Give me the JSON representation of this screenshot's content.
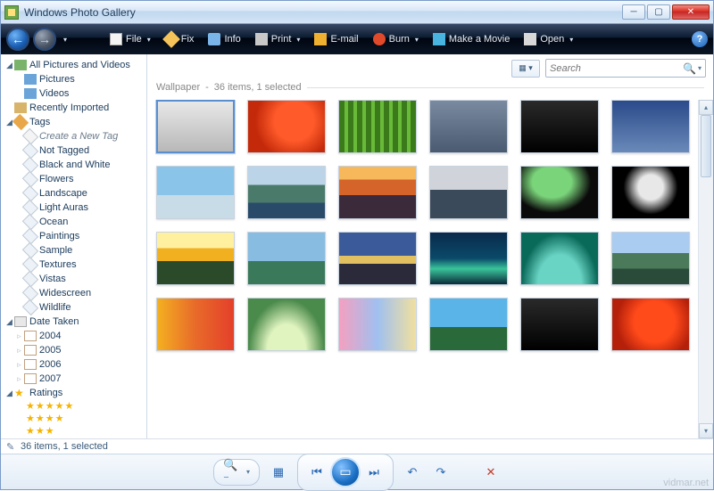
{
  "window": {
    "title": "Windows Photo Gallery"
  },
  "toolbar": {
    "file": "File",
    "fix": "Fix",
    "info": "Info",
    "print": "Print",
    "email": "E-mail",
    "burn": "Burn",
    "movie": "Make a Movie",
    "open": "Open"
  },
  "search": {
    "placeholder": "Search"
  },
  "tree": {
    "root": "All Pictures and Videos",
    "pictures": "Pictures",
    "videos": "Videos",
    "recent": "Recently Imported",
    "tags": "Tags",
    "create_tag": "Create a New Tag",
    "tag_items": [
      "Not Tagged",
      "Black and White",
      "Flowers",
      "Landscape",
      "Light Auras",
      "Ocean",
      "Paintings",
      "Sample",
      "Textures",
      "Vistas",
      "Widescreen",
      "Wildlife"
    ],
    "date": "Date Taken",
    "years": [
      "2004",
      "2005",
      "2006",
      "2007"
    ],
    "ratings": "Ratings"
  },
  "breadcrumb": {
    "folder": "Wallpaper",
    "summary": "36 items, 1 selected"
  },
  "status": {
    "text": "36 items, 1 selected"
  },
  "thumbs": {
    "count": 24,
    "selected_index": 0,
    "classes": [
      "g1",
      "g2",
      "g3",
      "g4",
      "g5",
      "g6",
      "g7",
      "g8",
      "g9",
      "g10",
      "g11",
      "g12",
      "g13",
      "g14",
      "g15",
      "g16",
      "g17",
      "g18",
      "g19",
      "g20",
      "g21",
      "g22",
      "g23",
      "g24"
    ]
  },
  "watermark": "vidmar.net",
  "icons": {
    "file": "#f4f4f4",
    "fix": "#f4c45a",
    "info": "#7ab4e8",
    "print": "#c8c8c8",
    "email": "#f0b030",
    "burn": "#e04a2a",
    "movie": "#4ab4e0",
    "open": "#d8d8d8"
  }
}
